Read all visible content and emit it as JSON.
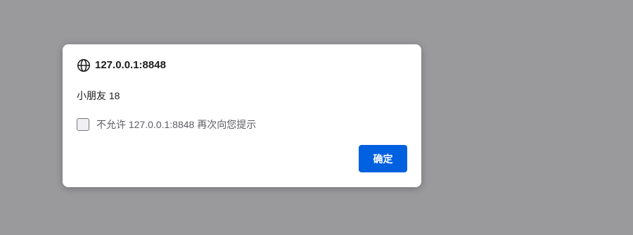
{
  "dialog": {
    "origin": "127.0.0.1:8848",
    "origin_icon": "globe-icon",
    "message": "小朋友 18",
    "checkbox_label": "不允许 127.0.0.1:8848 再次向您提示",
    "checkbox_checked": false,
    "ok_label": "确定"
  },
  "colors": {
    "overlay": "#9a9a9c",
    "dialog_bg": "#ffffff",
    "primary_button": "#0061e0"
  }
}
